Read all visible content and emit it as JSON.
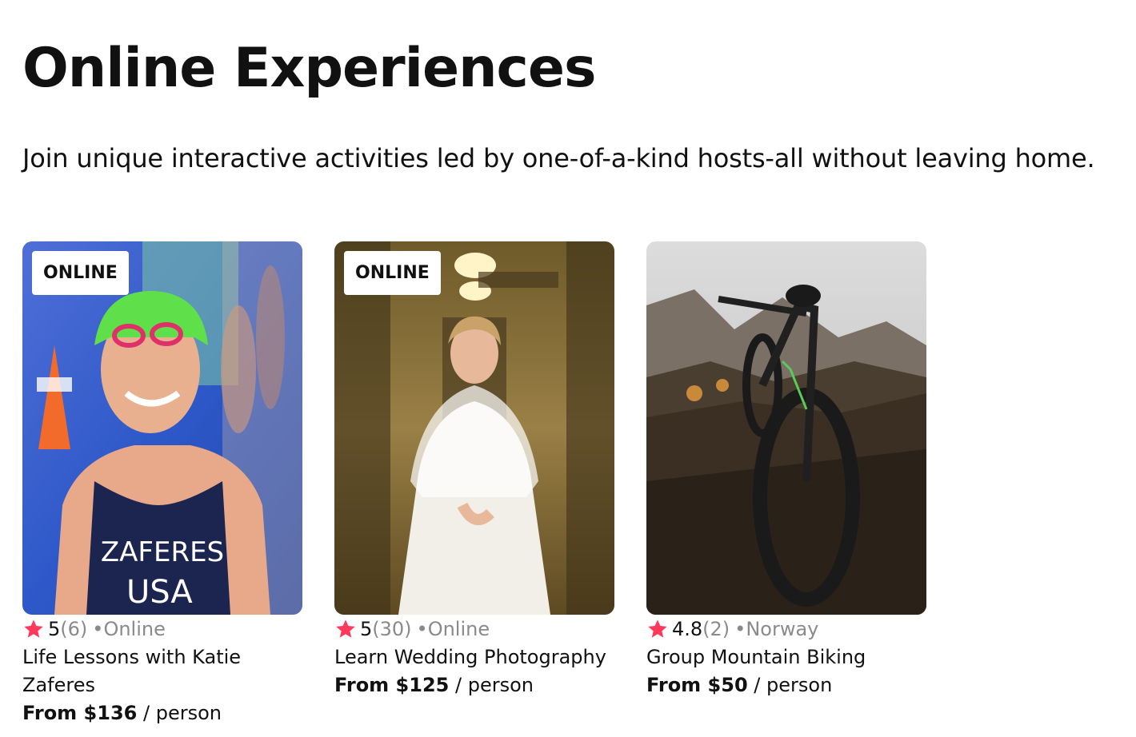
{
  "header": {
    "title": "Online Experiences",
    "subtitle": "Join unique interactive activities led by one-of-a-kind hosts-all without leaving home."
  },
  "star_color": "#ff385c",
  "cards": [
    {
      "badge": "ONLINE",
      "rating": "5",
      "review_count": "(6)",
      "location": "Online",
      "title": "Life Lessons with Katie Zaferes",
      "price": "From $136",
      "per": "person",
      "image": "swimmer-photo"
    },
    {
      "badge": "ONLINE",
      "rating": "5",
      "review_count": "(30)",
      "location": "Online",
      "title": "Learn Wedding Photography",
      "price": "From $125",
      "per": "person",
      "image": "bride-photo"
    },
    {
      "badge": "",
      "rating": "4.8",
      "review_count": "(2)",
      "location": "Norway",
      "title": "Group Mountain Biking",
      "price": "From $50",
      "per": "person",
      "image": "mountain-bike-photo"
    }
  ]
}
